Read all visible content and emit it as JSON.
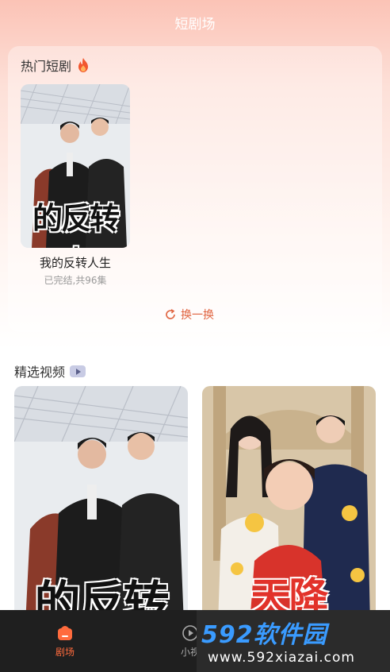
{
  "header": {
    "title": "短剧场"
  },
  "hot_section": {
    "title": "热门短剧",
    "title_icon": "flame-icon",
    "drama": {
      "poster_text": "的反转人",
      "name": "我的反转人生",
      "status": "已完结,共96集"
    },
    "refresh_label": "换一换",
    "refresh_icon": "refresh-icon"
  },
  "featured_section": {
    "title": "精选视频",
    "title_icon": "play-badge-icon",
    "videos": [
      {
        "poster_text": "的反转"
      },
      {
        "poster_text": "天降"
      }
    ]
  },
  "tabbar": {
    "tabs": [
      {
        "label": "剧场",
        "icon": "theater-icon",
        "active": true
      },
      {
        "label": "小视",
        "icon": "play-circle-icon",
        "active": false
      }
    ]
  },
  "watermark": {
    "line1": "592软件园",
    "line2": "www.592xiazai.com"
  },
  "colors": {
    "accent": "#e0633f",
    "tab_active": "#ff6b3d",
    "tabbar_bg": "#1f1f1f"
  }
}
